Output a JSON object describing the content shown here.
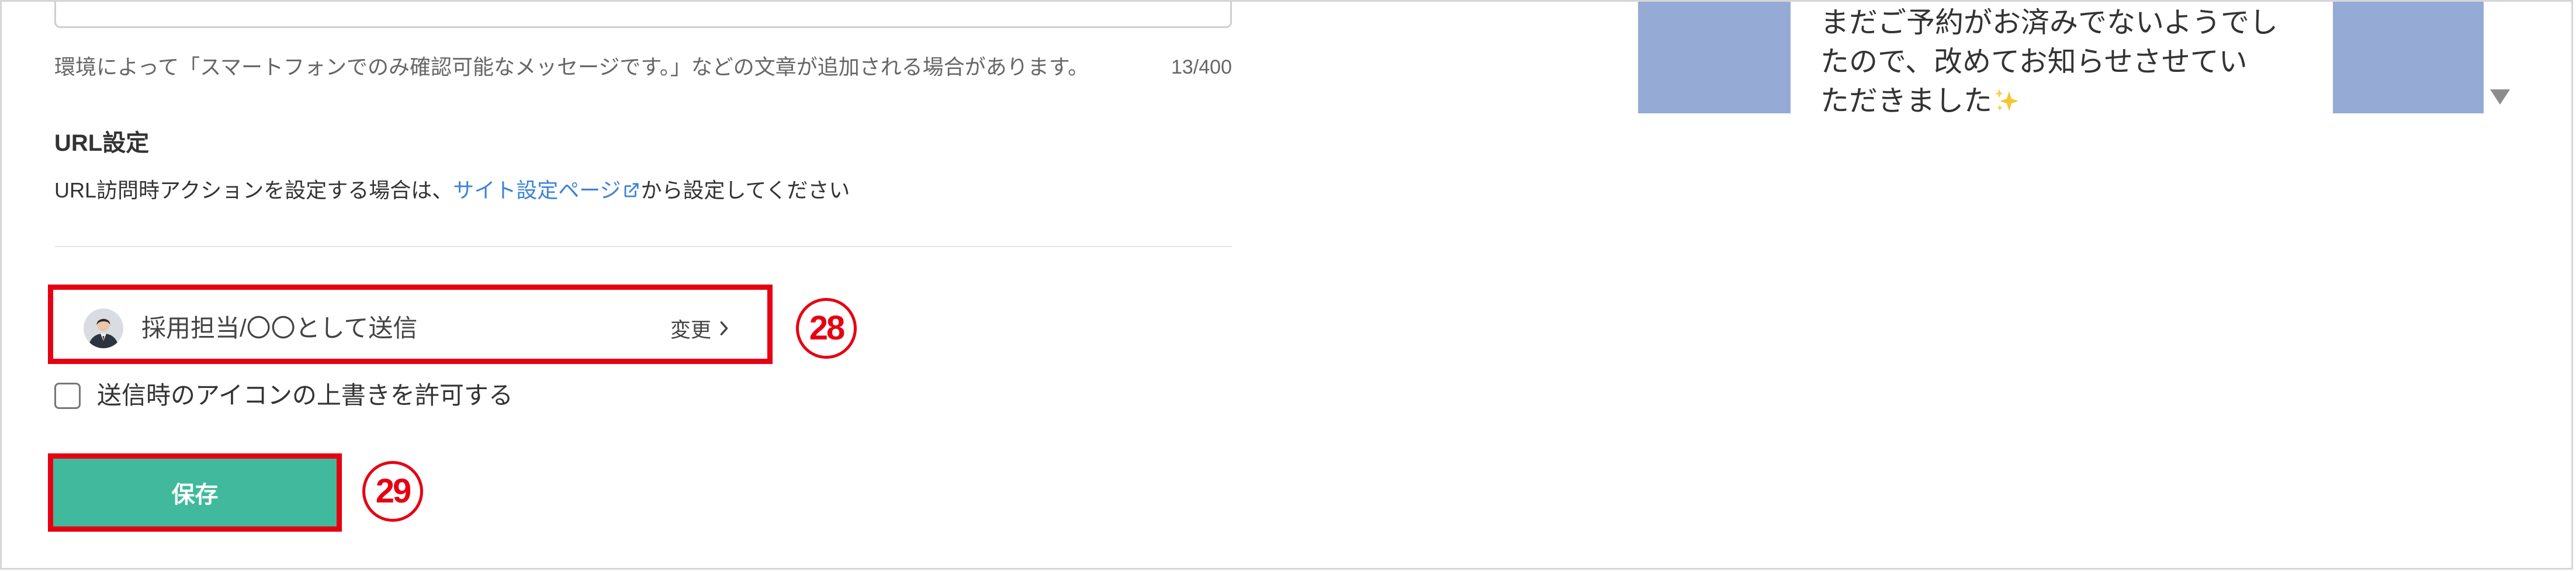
{
  "theme": {
    "highlight_red": "#e60012",
    "save_green": "#40b99c",
    "link_blue": "#3e82d6",
    "preview_image": "#95abd6",
    "text_dark": "#333333",
    "text_muted": "#666666"
  },
  "form": {
    "message_field": {
      "helper_text": "環境によって「スマートフォンでのみ確認可能なメッセージです。」などの文章が追加される場合があります。",
      "char_count": "13/400"
    },
    "url_settings": {
      "title": "URL設定",
      "description_prefix": "URL訪問時アクションを設定する場合は、",
      "link_text": "サイト設定ページ",
      "link_icon": "external-link-icon",
      "description_suffix": "から設定してください"
    },
    "sender": {
      "avatar_icon": "person-avatar-icon",
      "name": "採用担当/〇〇として送信",
      "change_label": "変更",
      "change_icon": "chevron-right-icon"
    },
    "override_icon_checkbox": {
      "label": "送信時のアイコンの上書きを許可する",
      "checked": false
    },
    "save_button": {
      "label": "保存"
    }
  },
  "annotations": {
    "sender_callout": "28",
    "save_callout": "29"
  },
  "preview": {
    "message_lines": [
      "まだご予約がお済みでないようでし",
      "たので、改めてお知らせさせてい",
      "ただきました"
    ],
    "message_end_icon": "sparkles-icon",
    "scroll_icon": "caret-down-icon"
  }
}
